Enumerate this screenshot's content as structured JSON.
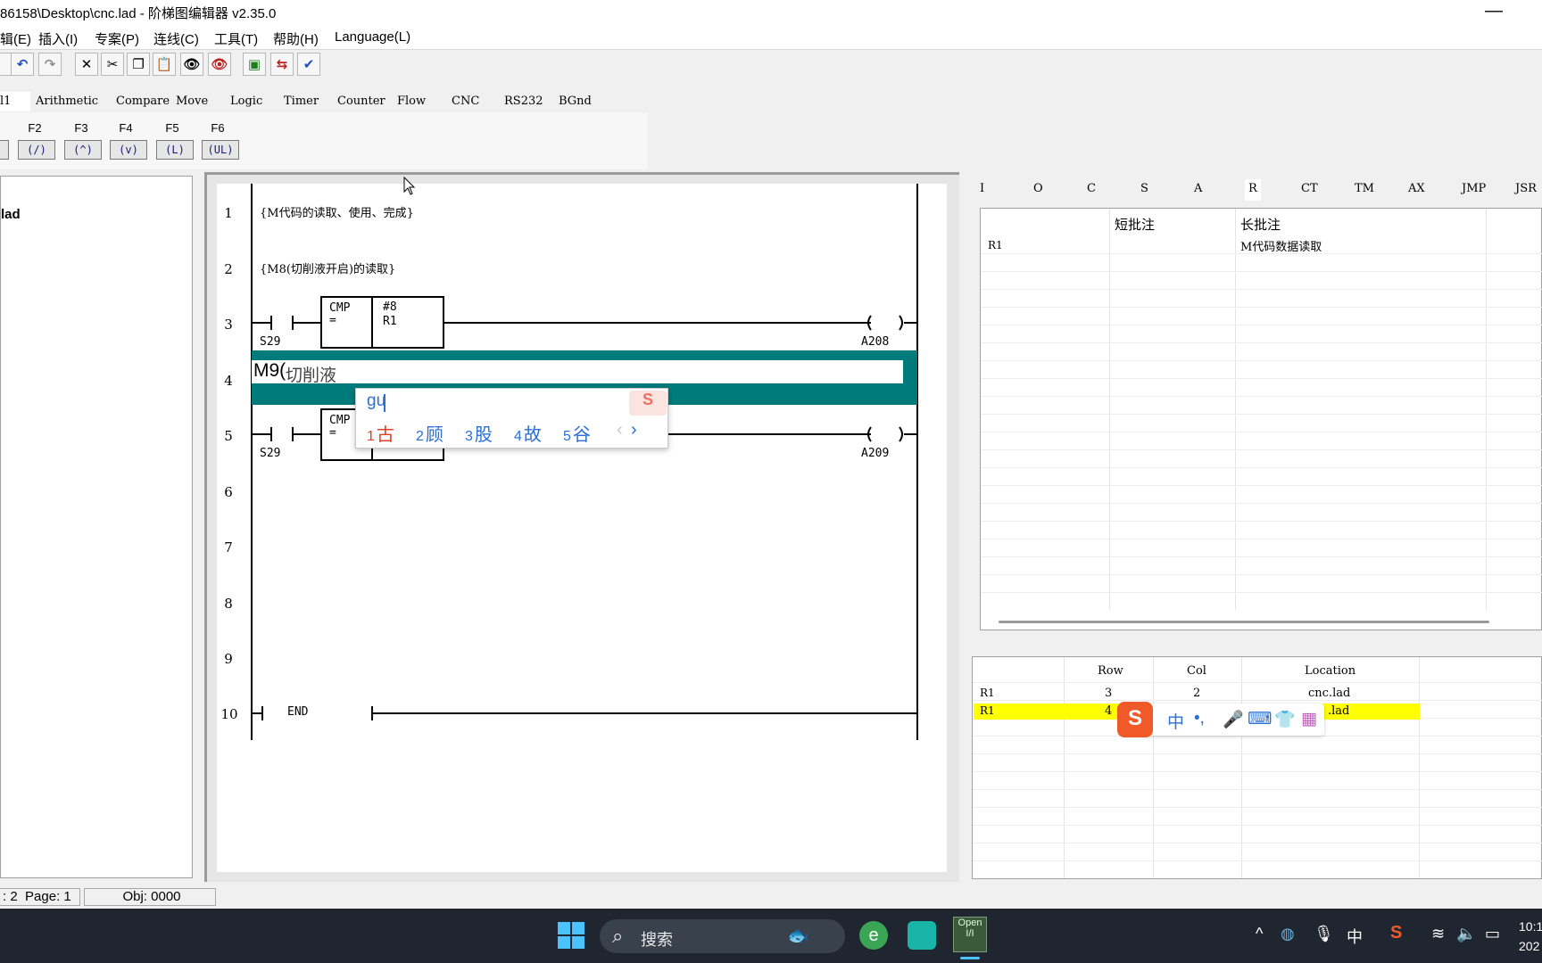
{
  "window": {
    "title": "86158\\Desktop\\cnc.lad - 阶梯图编辑器 v2.35.0",
    "minimize": "—"
  },
  "menu": [
    "辑(E)",
    "插入(I)",
    "专案(P)",
    "连线(C)",
    "工具(T)",
    "帮助(H)",
    "Language(L)"
  ],
  "toolbar": {
    "icons": [
      "undo-icon",
      "redo-icon",
      "delete-icon",
      "cut-icon",
      "copy-icon",
      "paste-icon",
      "find-icon",
      "replace-icon",
      "compile-icon",
      "monitor-icon",
      "verify-icon"
    ]
  },
  "instruction_tabs": [
    "l1",
    "Arithmetic",
    "Compare",
    "Move",
    "Logic",
    "Timer",
    "Counter",
    "Flow",
    "CNC",
    "RS232",
    "BGnd"
  ],
  "fkeys": [
    {
      "key": "F2",
      "symbol": "(/)"
    },
    {
      "key": "F3",
      "symbol": "(^)"
    },
    {
      "key": "F4",
      "symbol": "(v)"
    },
    {
      "key": "F5",
      "symbol": "(L)"
    },
    {
      "key": "F6",
      "symbol": "(UL)"
    }
  ],
  "project_tree": {
    "file": "lad"
  },
  "ladder": {
    "rows": [
      "1",
      "2",
      "3",
      "4",
      "5",
      "6",
      "7",
      "8",
      "9",
      "10"
    ],
    "row1_comment": "{M代码的读取、使用、完成}",
    "row2_comment": "{M8(切削液开启)的读取}",
    "row3": {
      "contact": "S29",
      "cmp_op": "CMP",
      "cmp_eq": "=",
      "cmp_val": "#8",
      "cmp_reg": "R1",
      "coil": "A208"
    },
    "row4_edit_text": "M9(",
    "row4_edit_composing": "切削液",
    "row5": {
      "contact": "S29",
      "cmp_op": "CMP",
      "cmp_eq": "=",
      "coil": "A209"
    },
    "row10_label": "END"
  },
  "ime": {
    "composition": "gu",
    "candidates": [
      {
        "n": "1",
        "ch": "古"
      },
      {
        "n": "2",
        "ch": "顾"
      },
      {
        "n": "3",
        "ch": "股"
      },
      {
        "n": "4",
        "ch": "故"
      },
      {
        "n": "5",
        "ch": "谷"
      }
    ],
    "prev": "‹",
    "next": "›"
  },
  "register_tabs": [
    "I",
    "O",
    "C",
    "S",
    "A",
    "R",
    "CT",
    "TM",
    "AX",
    "JMP",
    "JSR"
  ],
  "register_table": {
    "headers": [
      "",
      "短批注",
      "长批注"
    ],
    "rows": [
      [
        "R1",
        "",
        "M代码数据读取"
      ]
    ]
  },
  "xref_table": {
    "headers": [
      "",
      "Row",
      "Col",
      "Location"
    ],
    "rows": [
      [
        "R1",
        "3",
        "2",
        "cnc.lad"
      ],
      [
        "R1",
        "4",
        "",
        ".lad"
      ]
    ]
  },
  "ime_toolbar": [
    "中",
    "•,",
    "🎤",
    "⌨",
    "👕",
    "▦"
  ],
  "status": {
    "row": ": 2",
    "page": "Page: 1",
    "obj": "Obj: 0000"
  },
  "taskbar": {
    "search_placeholder": "搜索",
    "tray_lang": "中",
    "time": "10:1",
    "date": "202"
  },
  "colors": {
    "teal_highlight": "#007b7b",
    "selected_row": "#ffff00",
    "ime_blue": "#2a6fd6",
    "ime_red": "#e0402a"
  }
}
